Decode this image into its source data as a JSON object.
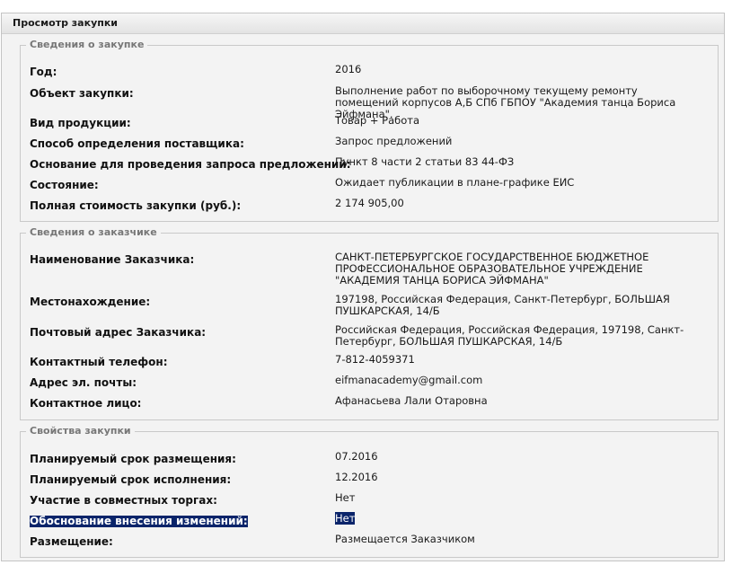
{
  "panel": {
    "title": "Просмотр закупки"
  },
  "purchase": {
    "legend": "Сведения о закупке",
    "rows": [
      {
        "label": "Год:",
        "value": "2016"
      },
      {
        "label": "Объект закупки:",
        "value": "Выполнение работ по выборочному текущему ремонту помещений корпусов А,Б СПб ГБПОУ \"Академия танца Бориса Эйфмана\"."
      },
      {
        "label": "Вид продукции:",
        "value": "Товар + Работа"
      },
      {
        "label": "Способ определения поставщика:",
        "value": "Запрос предложений"
      },
      {
        "label": "Основание для проведения запроса предложений:",
        "value": "Пункт 8 части 2 статьи 83 44-ФЗ"
      },
      {
        "label": "Состояние:",
        "value": "Ожидает публикации в плане-графике ЕИС"
      },
      {
        "label": "Полная стоимость закупки (руб.):",
        "value": "2 174 905,00"
      }
    ]
  },
  "customer": {
    "legend": "Сведения о заказчике",
    "rows": [
      {
        "label": "Наименование Заказчика:",
        "value": "САНКТ-ПЕТЕРБУРГСКОЕ ГОСУДАРСТВЕННОЕ БЮДЖЕТНОЕ ПРОФЕССИОНАЛЬНОЕ ОБРАЗОВАТЕЛЬНОЕ УЧРЕЖДЕНИЕ \"АКАДЕМИЯ ТАНЦА БОРИСА ЭЙФМАНА\""
      },
      {
        "label": "Местонахождение:",
        "value": "197198, Российская Федерация, Санкт-Петербург, БОЛЬШАЯ ПУШКАРСКАЯ, 14/Б"
      },
      {
        "label": "Почтовый адрес Заказчика:",
        "value": "Российская Федерация, Российская Федерация, 197198, Санкт-Петербург, БОЛЬШАЯ ПУШКАРСКАЯ, 14/Б"
      },
      {
        "label": "Контактный телефон:",
        "value": "7-812-4059371"
      },
      {
        "label": "Адрес эл. почты:",
        "value": "eifmanacademy@gmail.com"
      },
      {
        "label": "Контактное лицо:",
        "value": "Афанасьева Лали Отаровна"
      }
    ]
  },
  "properties": {
    "legend": "Свойства закупки",
    "rows": [
      {
        "label": "Планируемый срок размещения:",
        "value": "07.2016"
      },
      {
        "label": "Планируемый срок исполнения:",
        "value": "12.2016"
      },
      {
        "label": "Участие в совместных торгах:",
        "value": "Нет"
      },
      {
        "label": "Обоснование внесения изменений:",
        "value": "Нет"
      },
      {
        "label": "Размещение:",
        "value": "Размещается Заказчиком"
      }
    ]
  },
  "colors": {
    "selection": "#0a246a",
    "panel_bg": "#f3f3f3",
    "border": "#c9c9c9"
  }
}
